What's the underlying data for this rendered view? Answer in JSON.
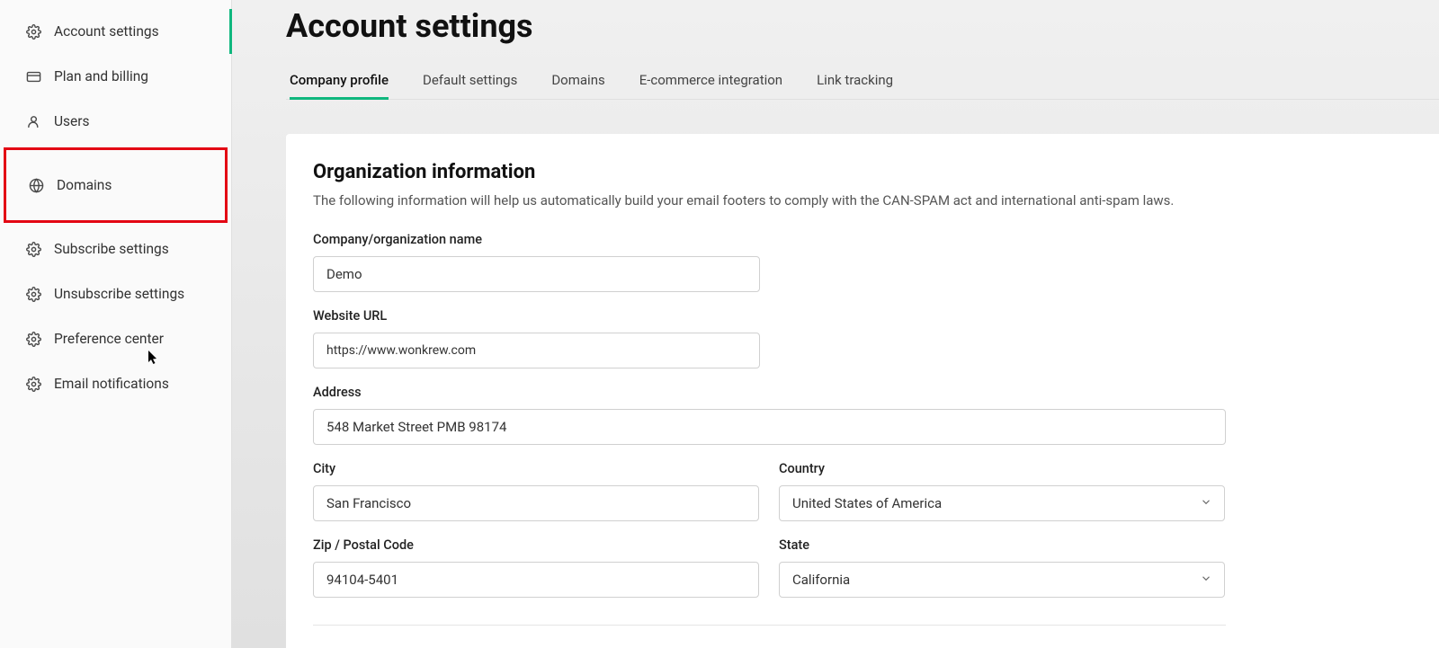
{
  "sidebar": {
    "items": [
      {
        "label": "Account settings",
        "icon": "gear"
      },
      {
        "label": "Plan and billing",
        "icon": "card"
      },
      {
        "label": "Users",
        "icon": "user"
      },
      {
        "label": "Domains",
        "icon": "globe"
      },
      {
        "label": "Subscribe settings",
        "icon": "gear"
      },
      {
        "label": "Unsubscribe settings",
        "icon": "gear"
      },
      {
        "label": "Preference center",
        "icon": "gear"
      },
      {
        "label": "Email notifications",
        "icon": "gear"
      }
    ]
  },
  "page": {
    "title": "Account settings"
  },
  "tabs": [
    {
      "label": "Company profile"
    },
    {
      "label": "Default settings"
    },
    {
      "label": "Domains"
    },
    {
      "label": "E-commerce integration"
    },
    {
      "label": "Link tracking"
    }
  ],
  "org_section": {
    "title": "Organization information",
    "description": "The following information will help us automatically build your email footers to comply with the CAN-SPAM act and international anti-spam laws."
  },
  "form": {
    "company_label": "Company/organization name",
    "company_value": "Demo",
    "website_label": "Website URL",
    "website_value": "https://www.wonkrew.com",
    "address_label": "Address",
    "address_value": "548 Market Street PMB 98174",
    "city_label": "City",
    "city_value": "San Francisco",
    "country_label": "Country",
    "country_value": "United States of America",
    "zip_label": "Zip / Postal Code",
    "zip_value": "94104-5401",
    "state_label": "State",
    "state_value": "California"
  }
}
